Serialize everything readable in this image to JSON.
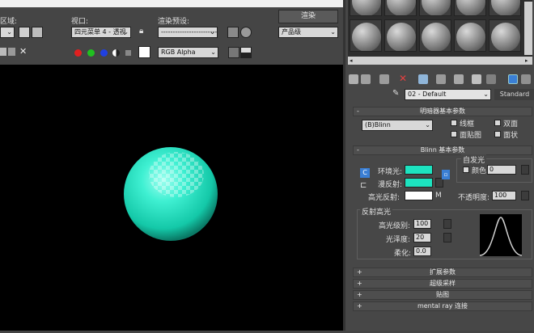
{
  "toolbar": {
    "area_label": "区域:",
    "viewport_label": "视口:",
    "viewport_value": "四元菜单 4 - 透视",
    "preset_label": "渲染预设:",
    "preset_value": "------------------------",
    "render_button": "渲染",
    "product_value": "产品级",
    "channel_value": "RGB Alpha"
  },
  "material_editor": {
    "material_name": "02 - Default",
    "material_type": "Standard",
    "rollouts": {
      "shader_basic": "明暗器基本参数",
      "blinn_basic": "Blinn 基本参数",
      "extended": "扩展参数",
      "supersampling": "超级采样",
      "maps": "贴图",
      "mental_ray": "mental ray 连接"
    },
    "shader": {
      "type_value": "(B)Blinn",
      "wire": "线框",
      "two_sided": "双面",
      "face_map": "面贴图",
      "faceted": "面状"
    },
    "blinn": {
      "ambient": "环境光:",
      "diffuse": "漫反射:",
      "specular": "高光反射:",
      "self_illum_title": "自发光",
      "color_label": "颜色",
      "self_illum_value": "0",
      "opacity_label": "不透明度:",
      "opacity_value": "100",
      "lock_c": "C",
      "lock_m": "M"
    },
    "specular_highlights": {
      "title": "反射高光",
      "level_label": "高光级别:",
      "level_value": "100",
      "gloss_label": "光泽度:",
      "gloss_value": "20",
      "soften_label": "柔化:",
      "soften_value": "0.0"
    },
    "colors": {
      "ambient": "#1de3c0",
      "diffuse": "#1de3c0",
      "specular": "#ffffff",
      "sphere": "#20e8c6"
    }
  }
}
